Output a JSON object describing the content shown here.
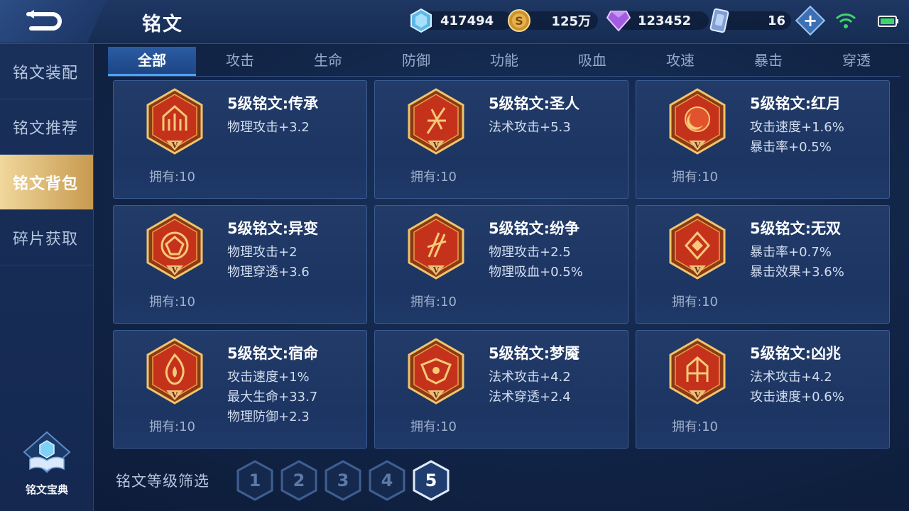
{
  "header": {
    "title": "铭文",
    "resources": [
      {
        "icon": "diamond-icon",
        "value": "417494"
      },
      {
        "icon": "gold-coin-icon",
        "value": "125万"
      },
      {
        "icon": "purple-gem-icon",
        "value": "123452"
      },
      {
        "icon": "card-ticket-icon",
        "value": "16"
      }
    ]
  },
  "sidebar": {
    "items": [
      {
        "label": "铭文装配"
      },
      {
        "label": "铭文推荐"
      },
      {
        "label": "铭文背包"
      },
      {
        "label": "碎片获取"
      }
    ],
    "active_index": 2,
    "codex_label": "铭文宝典"
  },
  "tabs": [
    "全部",
    "攻击",
    "生命",
    "防御",
    "功能",
    "吸血",
    "攻速",
    "暴击",
    "穿透"
  ],
  "active_tab": 0,
  "inscriptions": [
    {
      "name": "5级铭文:传承",
      "stats": [
        "物理攻击+3.2"
      ],
      "owned": "拥有:10",
      "tier": "V"
    },
    {
      "name": "5级铭文:圣人",
      "stats": [
        "法术攻击+5.3"
      ],
      "owned": "拥有:10",
      "tier": "V"
    },
    {
      "name": "5级铭文:红月",
      "stats": [
        "攻击速度+1.6%",
        "暴击率+0.5%"
      ],
      "owned": "拥有:10",
      "tier": "V"
    },
    {
      "name": "5级铭文:异变",
      "stats": [
        "物理攻击+2",
        "物理穿透+3.6"
      ],
      "owned": "拥有:10",
      "tier": "V"
    },
    {
      "name": "5级铭文:纷争",
      "stats": [
        "物理攻击+2.5",
        "物理吸血+0.5%"
      ],
      "owned": "拥有:10",
      "tier": "V"
    },
    {
      "name": "5级铭文:无双",
      "stats": [
        "暴击率+0.7%",
        "暴击效果+3.6%"
      ],
      "owned": "拥有:10",
      "tier": "V"
    },
    {
      "name": "5级铭文:宿命",
      "stats": [
        "攻击速度+1%",
        "最大生命+33.7",
        "物理防御+2.3"
      ],
      "owned": "拥有:10",
      "tier": "V"
    },
    {
      "name": "5级铭文:梦魇",
      "stats": [
        "法术攻击+4.2",
        "法术穿透+2.4"
      ],
      "owned": "拥有:10",
      "tier": "V"
    },
    {
      "name": "5级铭文:凶兆",
      "stats": [
        "法术攻击+4.2",
        "攻击速度+0.6%"
      ],
      "owned": "拥有:10",
      "tier": "V"
    }
  ],
  "level_filter": {
    "label": "铭文等级筛选",
    "levels": [
      "1",
      "2",
      "3",
      "4",
      "5"
    ],
    "selected": "5"
  },
  "colors": {
    "accent_blue": "#4fa3f2",
    "gold": "#d8b15f",
    "gem_red": "#c5321c"
  }
}
